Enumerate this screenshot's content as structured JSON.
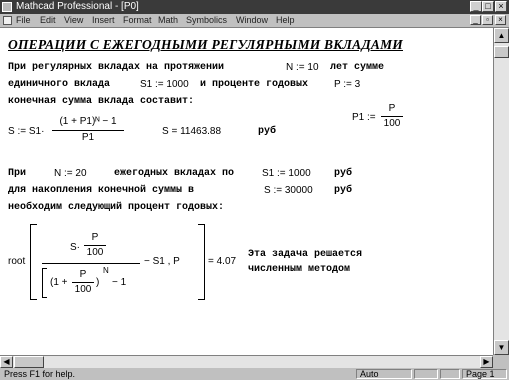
{
  "window": {
    "title": "Mathcad Professional - [P0]",
    "controls": {
      "minimize": "_",
      "maximize": "□",
      "close": "×"
    }
  },
  "menu": {
    "items": [
      "File",
      "Edit",
      "View",
      "Insert",
      "Format",
      "Math",
      "Symbolics",
      "Window",
      "Help"
    ],
    "doc_controls": {
      "minimize": "_",
      "restore": "▫",
      "close": "×"
    }
  },
  "document": {
    "heading": "ОПЕРАЦИИ С ЕЖЕГОДНЫМИ РЕГУЛЯРНЫМИ ВКЛАДАМИ",
    "p1": {
      "line1_a": "При регулярных вкладах на протяжении",
      "line1_eq": "N := 10",
      "line1_b": "лет сумме",
      "line2_a": "единичного вклада",
      "line2_eq": "S1 := 1000",
      "line2_b": "и проценте годовых",
      "line2_eq2": "P := 3",
      "line3": "конечная сумма вклада составит:"
    },
    "p1_formula": {
      "lhs": "P1 :=",
      "num": "P",
      "den": "100"
    },
    "s_formula": {
      "lhs": "S := S1·",
      "num": "(1 + P1)ᴺ − 1",
      "den": "P1",
      "result": "S = 11463.88",
      "unit": "руб"
    },
    "p2": {
      "line1_a": "При",
      "line1_eq": "N := 20",
      "line1_b": "ежегодных вкладах по",
      "line1_eq2": "S1 := 1000",
      "line1_c": "руб",
      "line2_a": "для накопления конечной суммы в",
      "line2_eq": "S := 30000",
      "line2_c": "руб",
      "line3": "необходим следующий процент годовых:"
    },
    "root_formula": {
      "root": "root",
      "num_s": "S·",
      "num_p": "P",
      "num_100": "100",
      "den_open": "(1 +",
      "den_p": "P",
      "den_100": "100",
      "den_close": ")",
      "exp_n": "N",
      "den_minus": "− 1",
      "tail": "− S1 , P",
      "result": "= 4.07"
    },
    "note": {
      "line1": "Эта задача решается",
      "line2": "численным методом"
    }
  },
  "statusbar": {
    "hint": "Press F1 for help.",
    "mode": "Auto",
    "page": "Page 1"
  }
}
